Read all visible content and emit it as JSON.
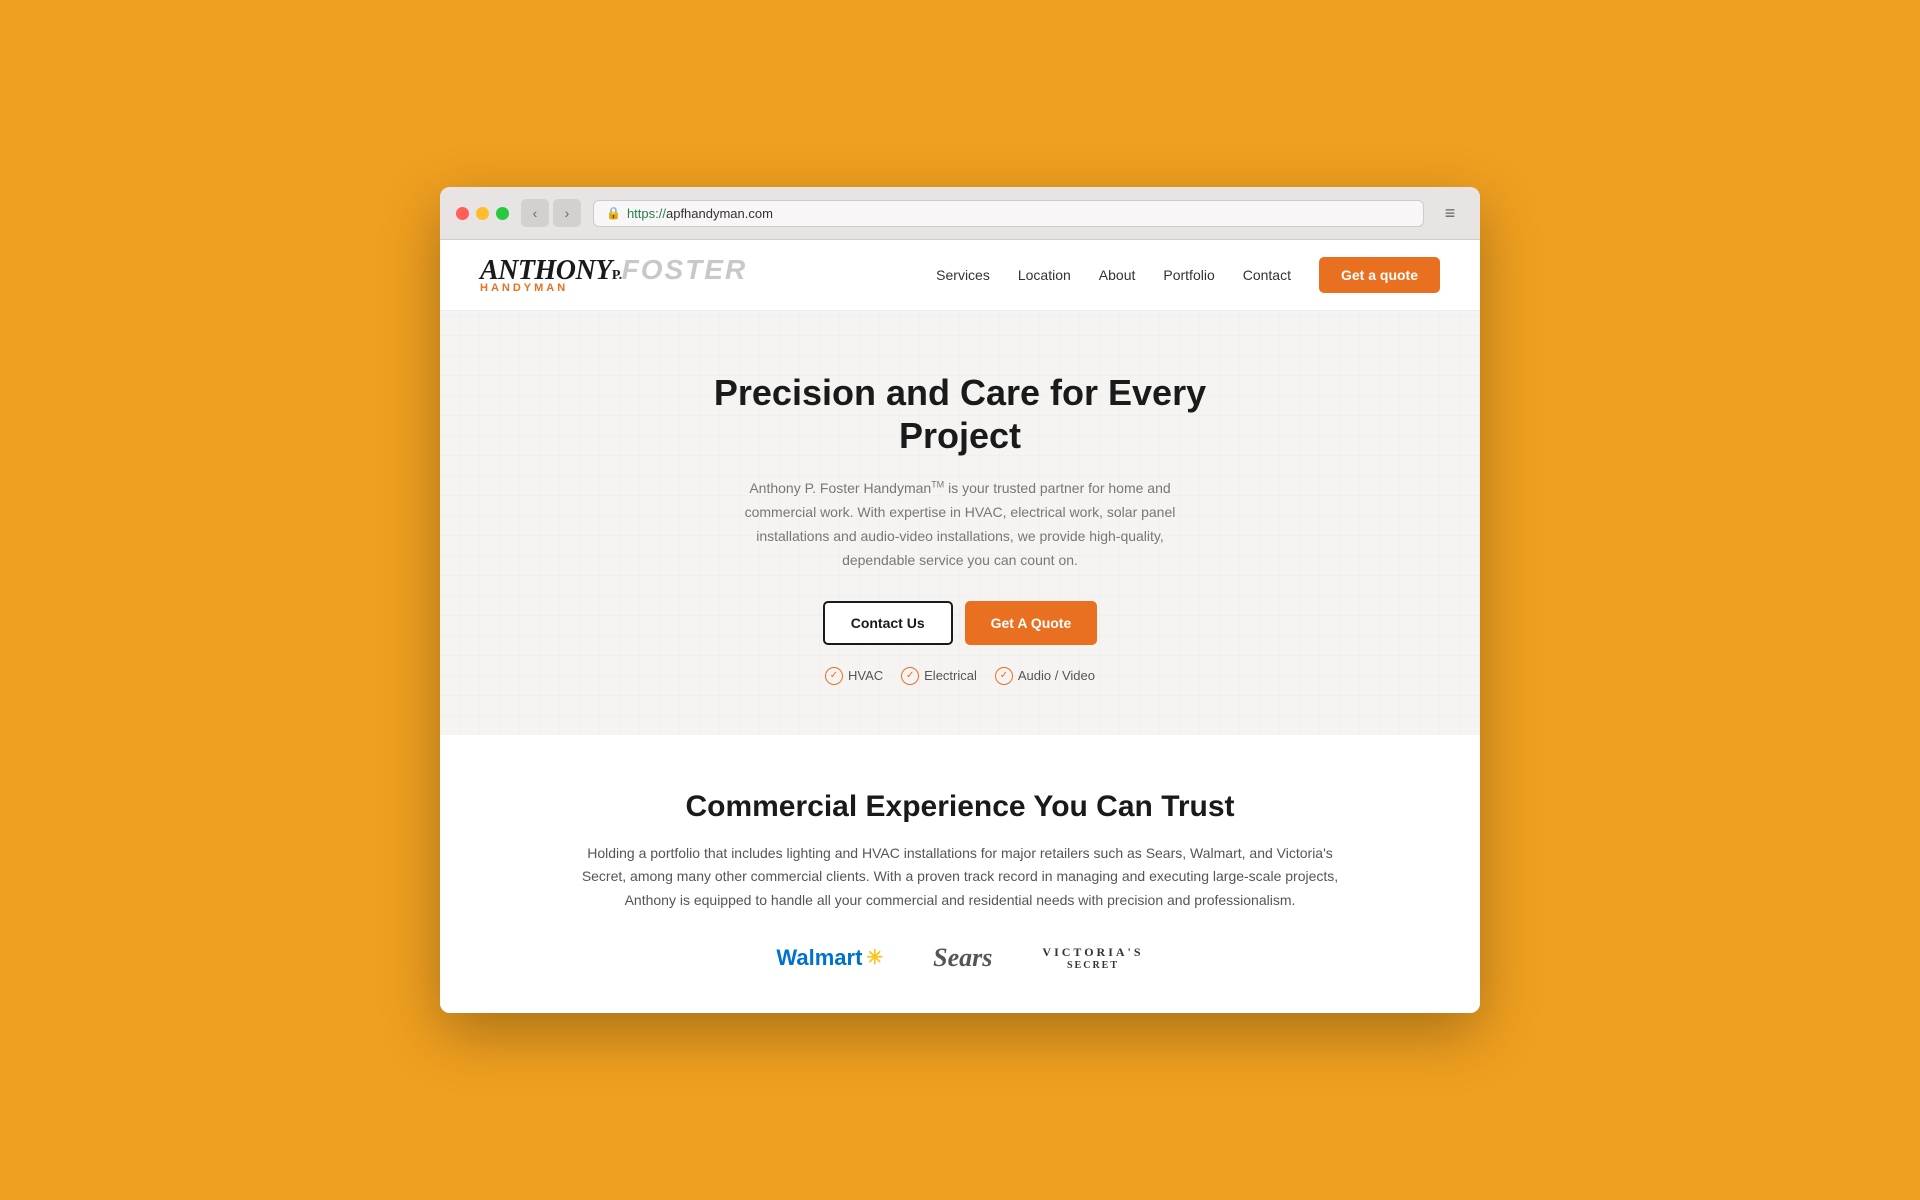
{
  "browser": {
    "url_protocol": "https://",
    "url_domain": "apfhandyman.com",
    "back_arrow": "‹",
    "forward_arrow": "›",
    "menu_icon": "≡"
  },
  "site": {
    "logo": {
      "anthony": "ANTHONY",
      "p": "P.",
      "foster": "FOSTER",
      "handyman": "HANDYMAN"
    },
    "nav": {
      "items": [
        {
          "label": "Services",
          "href": "#"
        },
        {
          "label": "Location",
          "href": "#"
        },
        {
          "label": "About",
          "href": "#"
        },
        {
          "label": "Portfolio",
          "href": "#"
        },
        {
          "label": "Contact",
          "href": "#"
        }
      ],
      "cta_label": "Get a quote"
    },
    "hero": {
      "title": "Precision and Care for Every Project",
      "description": "Anthony P. Foster Handyman™ is your trusted partner for home and commercial work. With expertise in HVAC, electrical work, solar panel installations and audio-video installations, we provide high-quality, dependable service you can count on.",
      "trademark": "TM",
      "contact_btn": "Contact Us",
      "quote_btn": "Get A Quote",
      "badges": [
        "HVAC",
        "Electrical",
        "Audio / Video"
      ]
    },
    "commercial": {
      "title": "Commercial Experience You Can Trust",
      "description": "Holding a portfolio that includes lighting and HVAC installations for major retailers such as Sears, Walmart, and Victoria's Secret, among many other commercial clients. With a proven track record in managing and executing large-scale projects, Anthony is equipped to handle all your commercial and residential needs with precision and professionalism.",
      "brands": [
        {
          "name": "Walmart",
          "type": "walmart"
        },
        {
          "name": "Sears",
          "type": "sears"
        },
        {
          "name": "Victoria's Secret",
          "type": "vs"
        }
      ]
    }
  }
}
